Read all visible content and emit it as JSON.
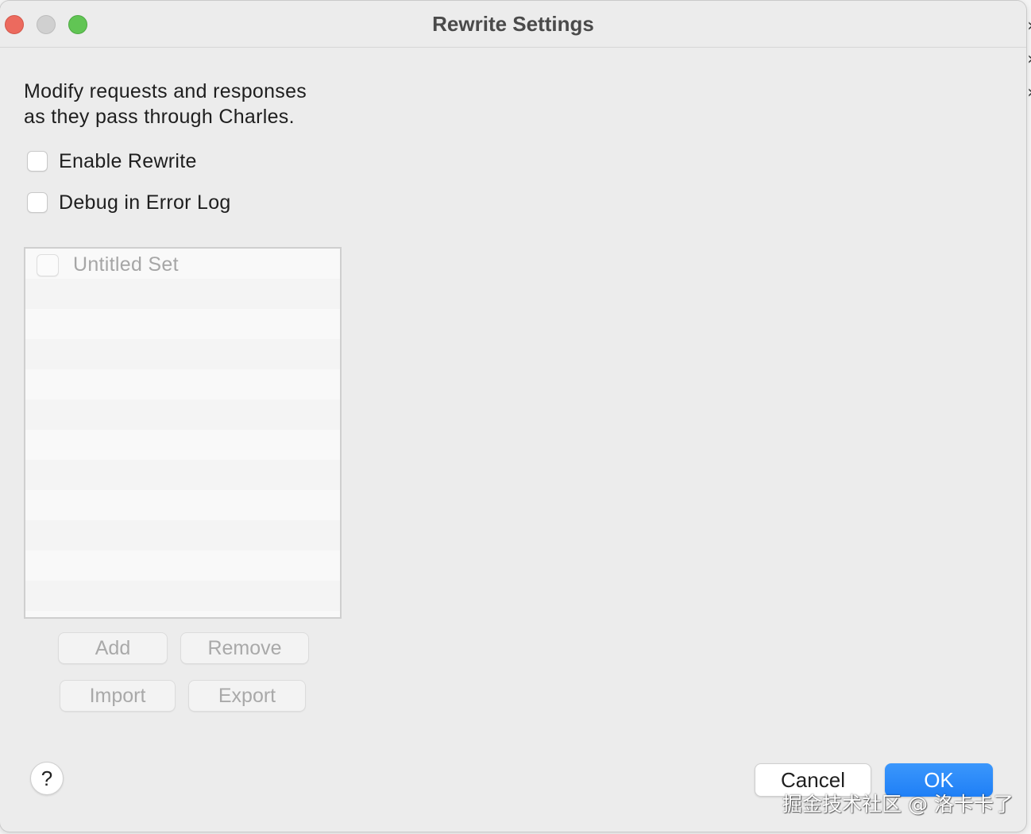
{
  "window": {
    "title": "Rewrite Settings"
  },
  "description": {
    "line1": "Modify requests and responses",
    "line2": "as they pass through Charles."
  },
  "options": {
    "enable_rewrite": {
      "label": "Enable Rewrite",
      "checked": false
    },
    "debug_error_log": {
      "label": "Debug in Error Log",
      "checked": false
    }
  },
  "sets": {
    "items": [
      {
        "label": "Untitled Set",
        "checked": false
      }
    ]
  },
  "set_buttons": {
    "add": "Add",
    "remove": "Remove",
    "import": "Import",
    "export": "Export"
  },
  "footer": {
    "help": "?",
    "cancel": "Cancel",
    "ok": "OK"
  },
  "watermark": "掘金技术社区 @ 洛卡卡了",
  "colors": {
    "ok_button": "#1f7ff6",
    "close_traffic": "#ec6a5e",
    "minimize_traffic": "#d0d0d0",
    "maximize_traffic": "#61c554"
  }
}
